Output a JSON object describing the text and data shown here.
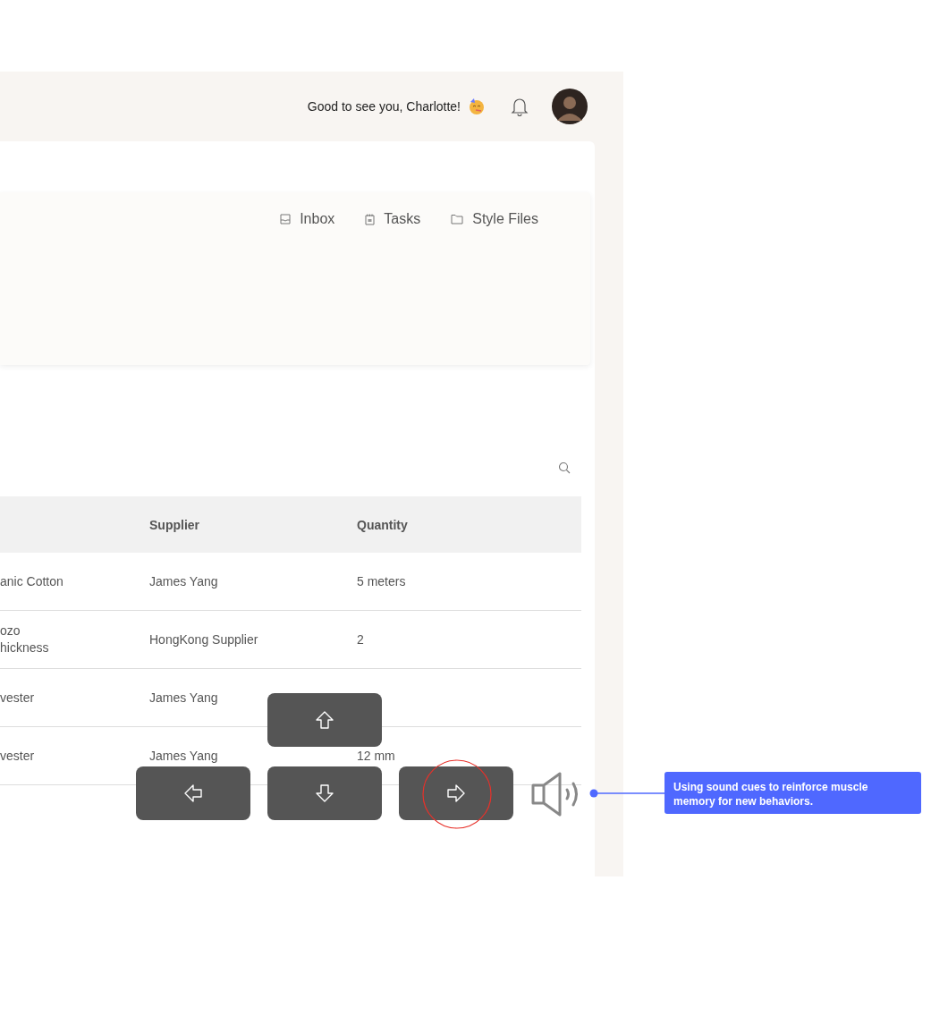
{
  "header": {
    "greeting": "Good to see you, Charlotte!"
  },
  "tabs": [
    {
      "label": "Inbox"
    },
    {
      "label": "Tasks"
    },
    {
      "label": "Style Files"
    }
  ],
  "table": {
    "columns": [
      "Supplier",
      "Quantity"
    ],
    "rows": [
      {
        "column_1": "anic Cotton",
        "supplier": "James Yang",
        "quantity": "5 meters"
      },
      {
        "column_1": "ozo\nhickness",
        "supplier": "HongKong Supplier",
        "quantity": "2"
      },
      {
        "column_1": "vester",
        "supplier": "James Yang"
      },
      {
        "column_1": "vester",
        "supplier": "James Yang",
        "quantity": "12 mm"
      }
    ]
  },
  "arrow_keys": [
    {
      "kind": "up",
      "highlighted": false
    },
    {
      "kind": "left",
      "highlighted": false
    },
    {
      "kind": "down",
      "highlighted": false
    },
    {
      "kind": "right",
      "highlighted": true
    }
  ],
  "annotation": {
    "text": "Using sound cues to reinforce muscle memory for new behaviors."
  }
}
